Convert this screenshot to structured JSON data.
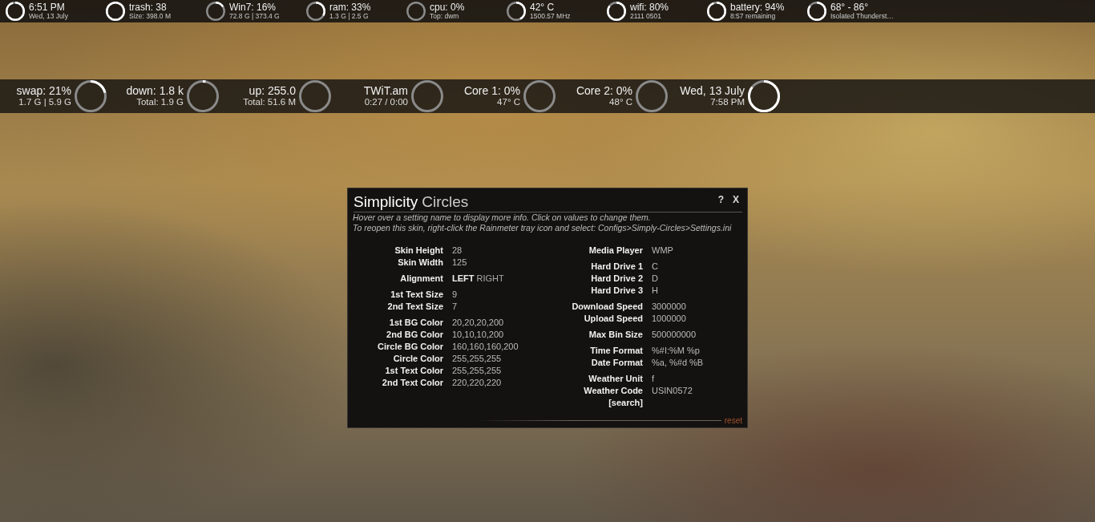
{
  "top_bar": [
    {
      "primary": "6:51 PM",
      "secondary": "Wed, 13 July",
      "level": 0.95
    },
    {
      "primary": "trash: 38",
      "secondary": "Size: 398.0 M",
      "level": 1
    },
    {
      "primary": "Win7: 16%",
      "secondary": "72.8 G | 373.4 G",
      "level": 0.16
    },
    {
      "primary": "ram: 33%",
      "secondary": "1.3 G | 2.5 G",
      "level": 0.33
    },
    {
      "primary": "cpu: 0%",
      "secondary": "Top: dwm",
      "level": 0
    },
    {
      "primary": "42° C",
      "secondary": "1500.57 MHz",
      "level": 0.42
    },
    {
      "primary": "wifi: 80%",
      "secondary": "2111 0501"
    },
    {
      "primary": "battery: 94%",
      "secondary": "8:57 remaining",
      "level": 0.94
    },
    {
      "primary": "68° - 86°",
      "secondary": "Isolated Thunderst…"
    }
  ],
  "second_bar": [
    {
      "primary": "swap: 21%",
      "secondary": "1.7 G | 5.9 G",
      "level": 0.21
    },
    {
      "primary": "down: 1.8 k",
      "secondary": "Total: 1.9 G",
      "level": 0.03
    },
    {
      "primary": "up: 255.0",
      "secondary": "Total: 51.6 M",
      "level": 0
    },
    {
      "primary": "TWiT.am",
      "secondary": "0:27 / 0:00",
      "level": 0
    },
    {
      "primary": "Core 1: 0%",
      "secondary": "47° C",
      "level": 0
    },
    {
      "primary": "Core 2: 0%",
      "secondary": "48° C",
      "level": 0
    },
    {
      "primary": "Wed, 13 July",
      "secondary": "7:58 PM"
    }
  ],
  "settings_window": {
    "title": "Simplicity",
    "subtitle": "Circles",
    "buttons": [
      "?",
      "X"
    ],
    "hints": [
      "Hover over a setting name to display more info. Click on values to change them.",
      "To reopen this skin, right-click the Rainmeter tray icon and select: Configs>Simply-Circles>Settings.ini"
    ],
    "columns": [
      {
        "groups": [
          [
            {
              "kind": "value",
              "label": "Skin Height",
              "value": "28"
            },
            {
              "kind": "value",
              "label": "Skin Width",
              "value": "125"
            }
          ],
          [
            {
              "kind": "options",
              "label": "Alignment",
              "options": [
                {
                  "text": "LEFT",
                  "selected": true
                },
                {
                  "text": "RIGHT",
                  "selected": false
                }
              ]
            }
          ],
          [
            {
              "kind": "value",
              "label": "1st Text Size",
              "value": "9"
            },
            {
              "kind": "value",
              "label": "2nd Text Size",
              "value": "7"
            }
          ],
          [
            {
              "kind": "value",
              "label": "1st BG Color",
              "value": "20,20,20,200"
            },
            {
              "kind": "value",
              "label": "2nd BG Color",
              "value": "10,10,10,200"
            },
            {
              "kind": "value",
              "label": "Circle BG Color",
              "value": "160,160,160,200"
            },
            {
              "kind": "value",
              "label": "Circle Color",
              "value": "255,255,255"
            },
            {
              "kind": "value",
              "label": "1st Text Color",
              "value": "255,255,255"
            },
            {
              "kind": "value",
              "label": "2nd Text Color",
              "value": "220,220,220"
            }
          ]
        ]
      },
      {
        "groups": [
          [
            {
              "kind": "value",
              "label": "Media Player",
              "value": "WMP"
            }
          ],
          [
            {
              "kind": "value",
              "label": "Hard Drive 1",
              "value": "C"
            },
            {
              "kind": "value",
              "label": "Hard Drive 2",
              "value": "D"
            },
            {
              "kind": "value",
              "label": "Hard Drive 3",
              "value": "H"
            }
          ],
          [
            {
              "kind": "value",
              "label": "Download Speed",
              "value": "3000000"
            },
            {
              "kind": "value",
              "label": "Upload Speed",
              "value": "1000000"
            }
          ],
          [
            {
              "kind": "value",
              "label": "Max Bin Size",
              "value": "500000000"
            }
          ],
          [
            {
              "kind": "value",
              "label": "Time Format",
              "value": "%#I:%M %p"
            },
            {
              "kind": "value",
              "label": "Date Format",
              "value": "%a, %#d %B"
            }
          ],
          [
            {
              "kind": "value",
              "label": "Weather Unit",
              "value": "f"
            },
            {
              "kind": "value",
              "label": "Weather Code",
              "value": "USIN0572"
            },
            {
              "kind": "link",
              "label": "[search]"
            }
          ]
        ]
      }
    ],
    "reset": "reset"
  }
}
